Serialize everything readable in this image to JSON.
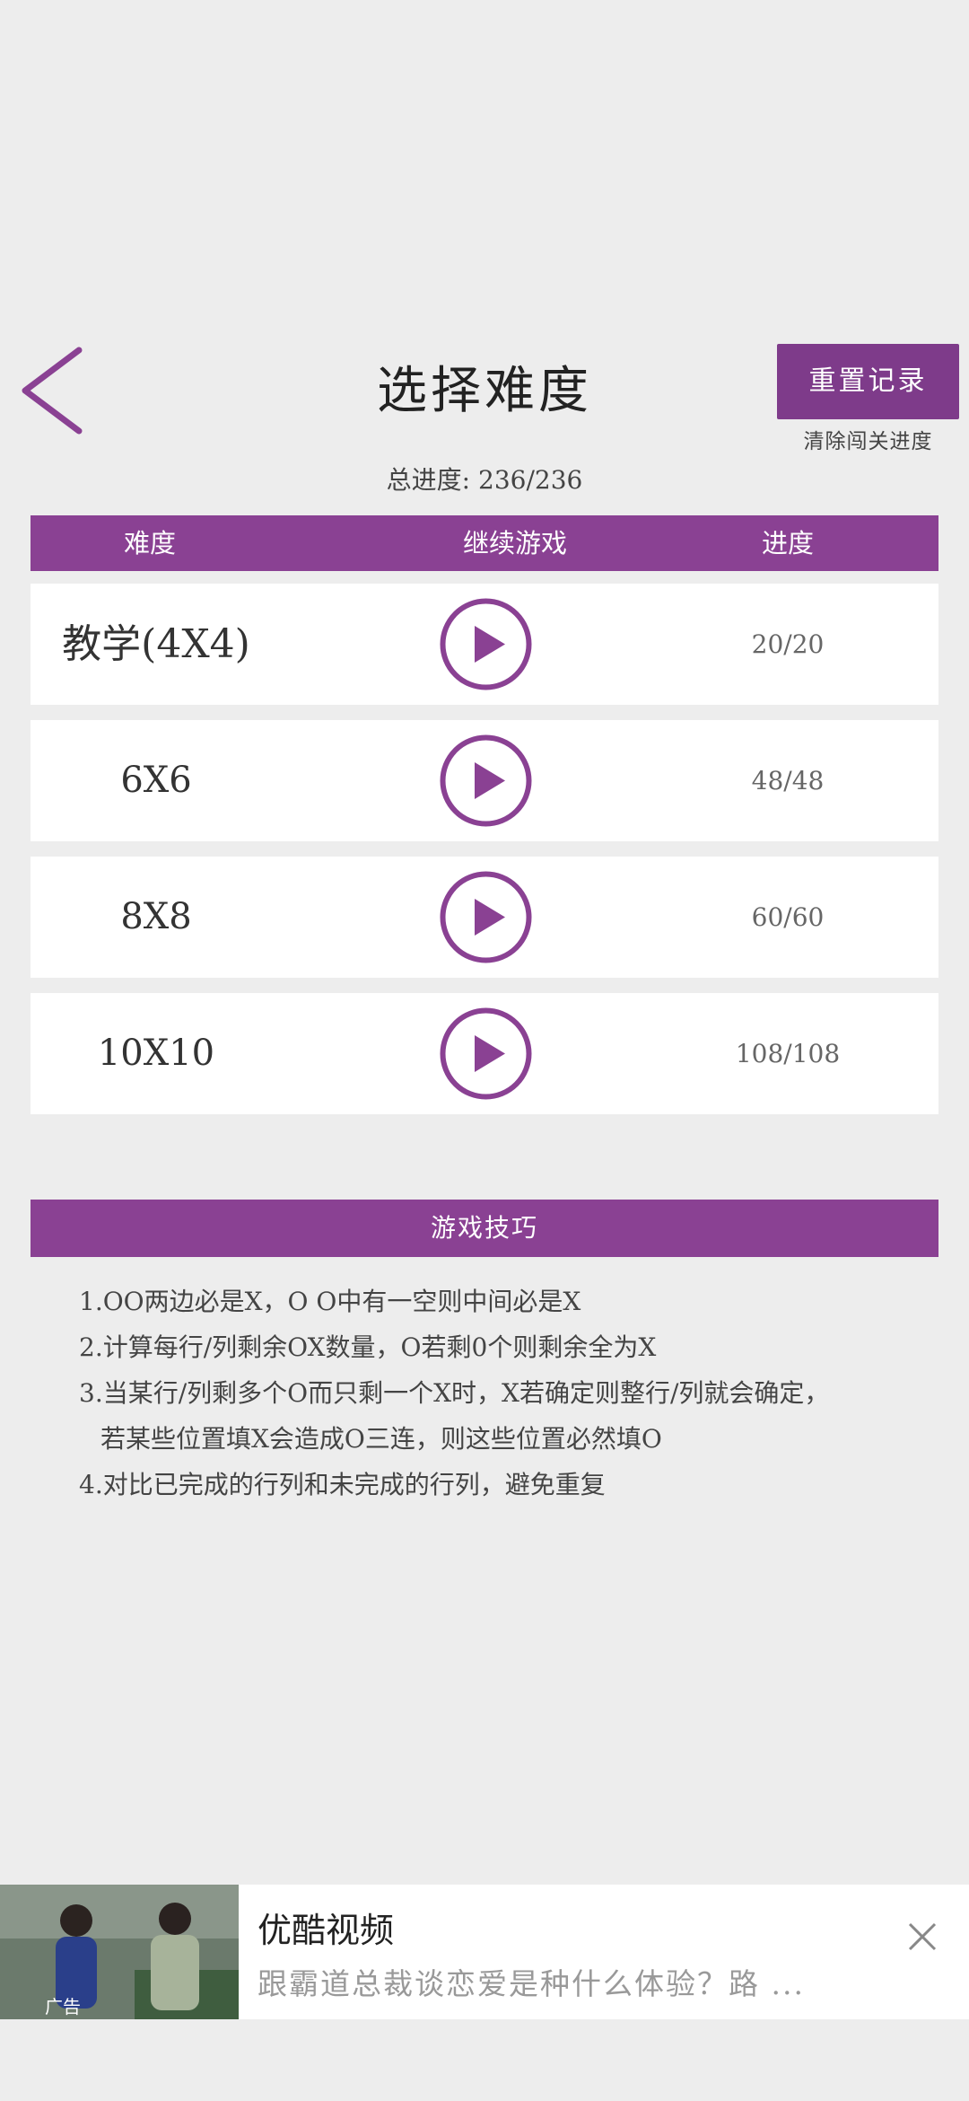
{
  "header": {
    "title": "选择难度",
    "reset_label": "重置记录",
    "reset_sub": "清除闯关进度",
    "total_progress": "总进度: 236/236"
  },
  "table": {
    "columns": [
      "难度",
      "继续游戏",
      "进度"
    ],
    "rows": [
      {
        "name": "教学(4X4)",
        "progress": "20/20"
      },
      {
        "name": "6X6",
        "progress": "48/48"
      },
      {
        "name": "8X8",
        "progress": "60/60"
      },
      {
        "name": "10X10",
        "progress": "108/108"
      }
    ]
  },
  "tips": {
    "heading": "游戏技巧",
    "lines": [
      "1.OO两边必是X，O O中有一空则中间必是X",
      "2.计算每行/列剩余OX数量，O若剩0个则剩余全为X",
      "3.当某行/列剩多个O而只剩一个X时，X若确定则整行/列就会确定，",
      "若某些位置填X会造成O三连，则这些位置必然填O",
      "4.对比已完成的行列和未完成的行列，避免重复"
    ]
  },
  "ad": {
    "title": "优酷视频",
    "desc": "跟霸道总裁谈恋爱是种什么体验？路 ...",
    "thumb_label": "广告"
  },
  "colors": {
    "accent": "#8a4193",
    "reset_bg": "#7e3b8a",
    "background": "#ededed"
  },
  "icons": {
    "back": "chevron-left-icon",
    "play": "play-circle-icon",
    "close": "close-icon"
  }
}
